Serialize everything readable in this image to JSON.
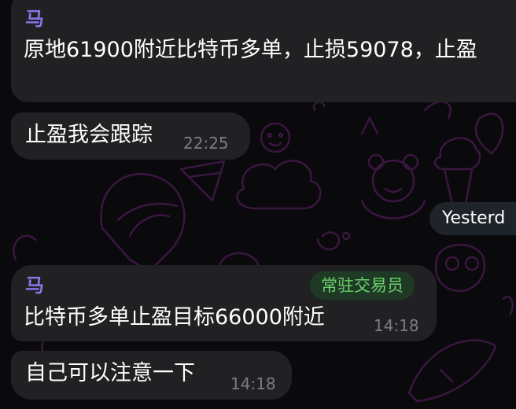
{
  "messages": [
    {
      "sender": "马",
      "text": "原地61900附近比特币多单，止损59078，止盈"
    },
    {
      "text": "止盈我会跟踪",
      "time": "22:25"
    },
    {
      "sender": "马",
      "role": "常驻交易员",
      "text": "比特币多单止盈目标66000附近",
      "time": "14:18"
    },
    {
      "text": "自己可以注意一下",
      "time": "14:18"
    }
  ],
  "date_separator": "Yesterd",
  "colors": {
    "background": "#0a090c",
    "bubble": "#212124",
    "sender_name": "#8b74e6",
    "role_badge_bg": "#1f3a24",
    "role_badge_text": "#6cd06e",
    "timestamp": "#7c7c82",
    "doodle_stroke": "#3a1740"
  }
}
